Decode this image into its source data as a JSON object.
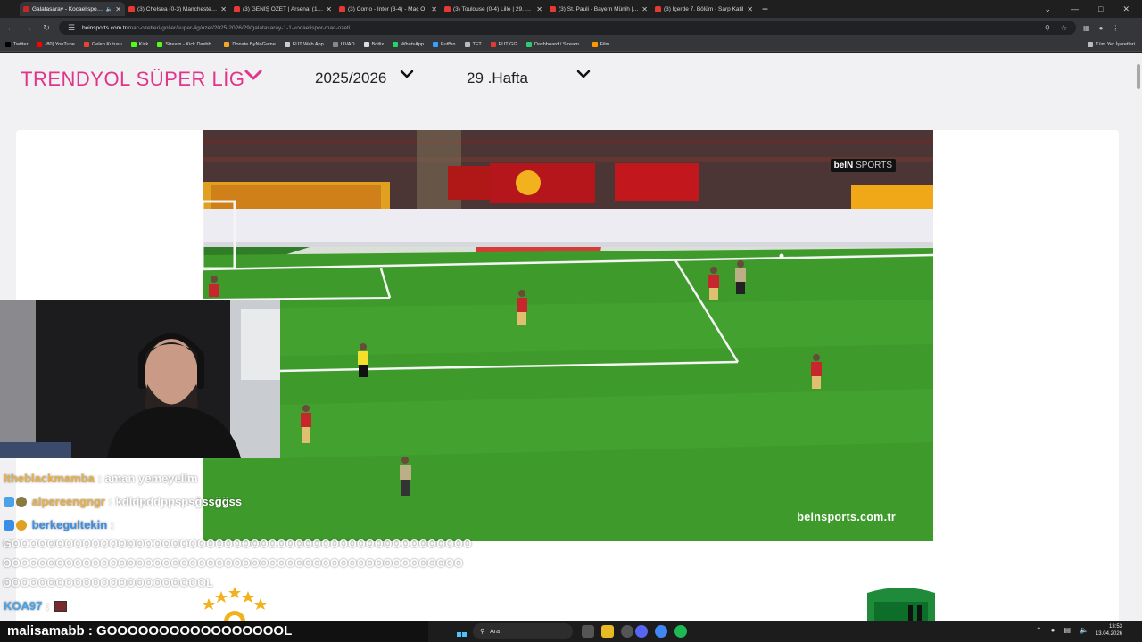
{
  "browser": {
    "tabs": [
      {
        "title": "Galatasaray - Kocaelispor M",
        "active": true
      },
      {
        "title": "(3) Chelsea (0-3) Manchester C",
        "active": false
      },
      {
        "title": "(3) GENİŞ ÖZET | Arsenal (1-2)",
        "active": false
      },
      {
        "title": "(3) Como - Inter (3-4) - Maç Ö",
        "active": false
      },
      {
        "title": "(3) Toulouse (0-4) Lille | 29. Haf",
        "active": false
      },
      {
        "title": "(3) St. Pauli - Bayern Münih | Bu",
        "active": false
      },
      {
        "title": "(3) İçerde 7. Bölüm - Sarp Katil",
        "active": false
      }
    ],
    "url_host": "beinsports.com.tr",
    "url_path": "/mac-ozetleri-goller/super-lig/ozet/2025-2026/29/galatasaray-1-1-kocaelispor-mac-ozeti",
    "bookmarks": [
      {
        "label": "Twitter",
        "color": "#000000"
      },
      {
        "label": "(80) YouTube",
        "color": "#ff0000"
      },
      {
        "label": "Gelen Kutusu",
        "color": "#ea4335"
      },
      {
        "label": "Kick",
        "color": "#53fc18"
      },
      {
        "label": "Stream - Kick Dashb...",
        "color": "#53fc18"
      },
      {
        "label": "Donate ByNoGame",
        "color": "#f5a623"
      },
      {
        "label": "FUT Web App",
        "color": "#cccccc"
      },
      {
        "label": "LIVAD",
        "color": "#888888"
      },
      {
        "label": "Botlix",
        "color": "#dddddd"
      },
      {
        "label": "WhatsApp",
        "color": "#25d366"
      },
      {
        "label": "FutBın",
        "color": "#3aa0ff"
      },
      {
        "label": "TFT",
        "color": "#bbbbbb"
      },
      {
        "label": "FUT GG",
        "color": "#e53935"
      },
      {
        "label": "Dashboard / Stream...",
        "color": "#2ecc71"
      },
      {
        "label": "Film",
        "color": "#ff9800"
      }
    ],
    "bookmarks_all": "Tüm Yer İşaretleri"
  },
  "page": {
    "league": "TRENDYOL SÜPER LİG",
    "season": "2025/2026",
    "week": "29 .Hafta",
    "accent": "#e0358a",
    "video": {
      "channel_logo": "beIN",
      "channel_logo_suffix": "SPORTS",
      "watermark": "beinsports.com.tr"
    }
  },
  "chat": {
    "lines": [
      {
        "user": "Itheblackmamba",
        "sep": " : ",
        "msg": "aman yemeyelim",
        "color": "#e8b04a"
      },
      {
        "user": "alpereengngr",
        "sep": " : ",
        "msg": "kdldpddppspsğssğğss",
        "color": "#e8b04a"
      },
      {
        "user": "berkegultekin",
        "sep": " :",
        "msg": "",
        "color": "#3a8ee8"
      }
    ],
    "spam": [
      "GOOOOOOOOOOOOOOOOOOOOOOOOOOOOOOOOOOOOOOOOOOOOOOOOOOOO",
      "OOOOOOOOOOOOOOOOOOOOOOOOOOOOOOOOOOOOOOOOOOOOOOOOOOOO",
      "OOOOOOOOOOOOOOOOOOOOOOOL"
    ],
    "koa_user": "KOA97",
    "koa_sep": " : ",
    "ticker_user": "malisamabb",
    "ticker_msg": " : GOOOOOOOOOOOOOOOOOL"
  },
  "taskbar": {
    "search_placeholder": "Ara",
    "time": "13:53",
    "date": "13.04.2026"
  }
}
